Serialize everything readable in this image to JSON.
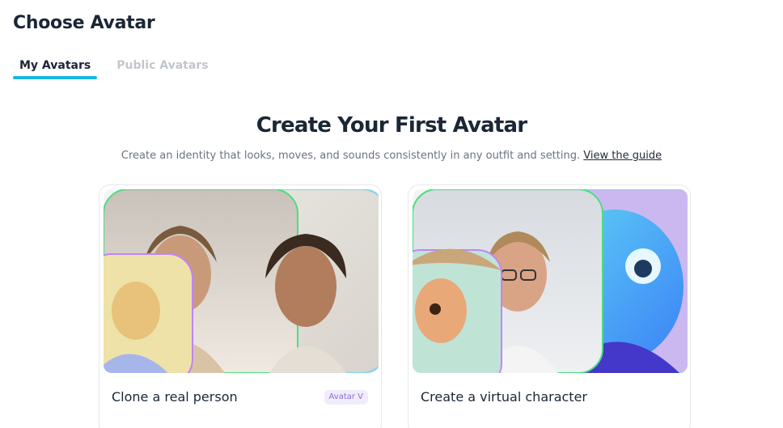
{
  "page": {
    "title": "Choose Avatar"
  },
  "tabs": [
    {
      "label": "My Avatars",
      "active": true
    },
    {
      "label": "Public Avatars",
      "active": false
    }
  ],
  "hero": {
    "title": "Create Your First Avatar",
    "subtitle": "Create an identity that looks, moves, and sounds consistently in any outfit and setting.",
    "guide_link": "View the guide"
  },
  "cards": [
    {
      "label": "Clone a real person",
      "badge": "Avatar V"
    },
    {
      "label": "Create a virtual character"
    }
  ],
  "colors": {
    "accent": "#19b8e3",
    "badge_bg": "#f1ecfb",
    "badge_text": "#8b6fd6"
  }
}
